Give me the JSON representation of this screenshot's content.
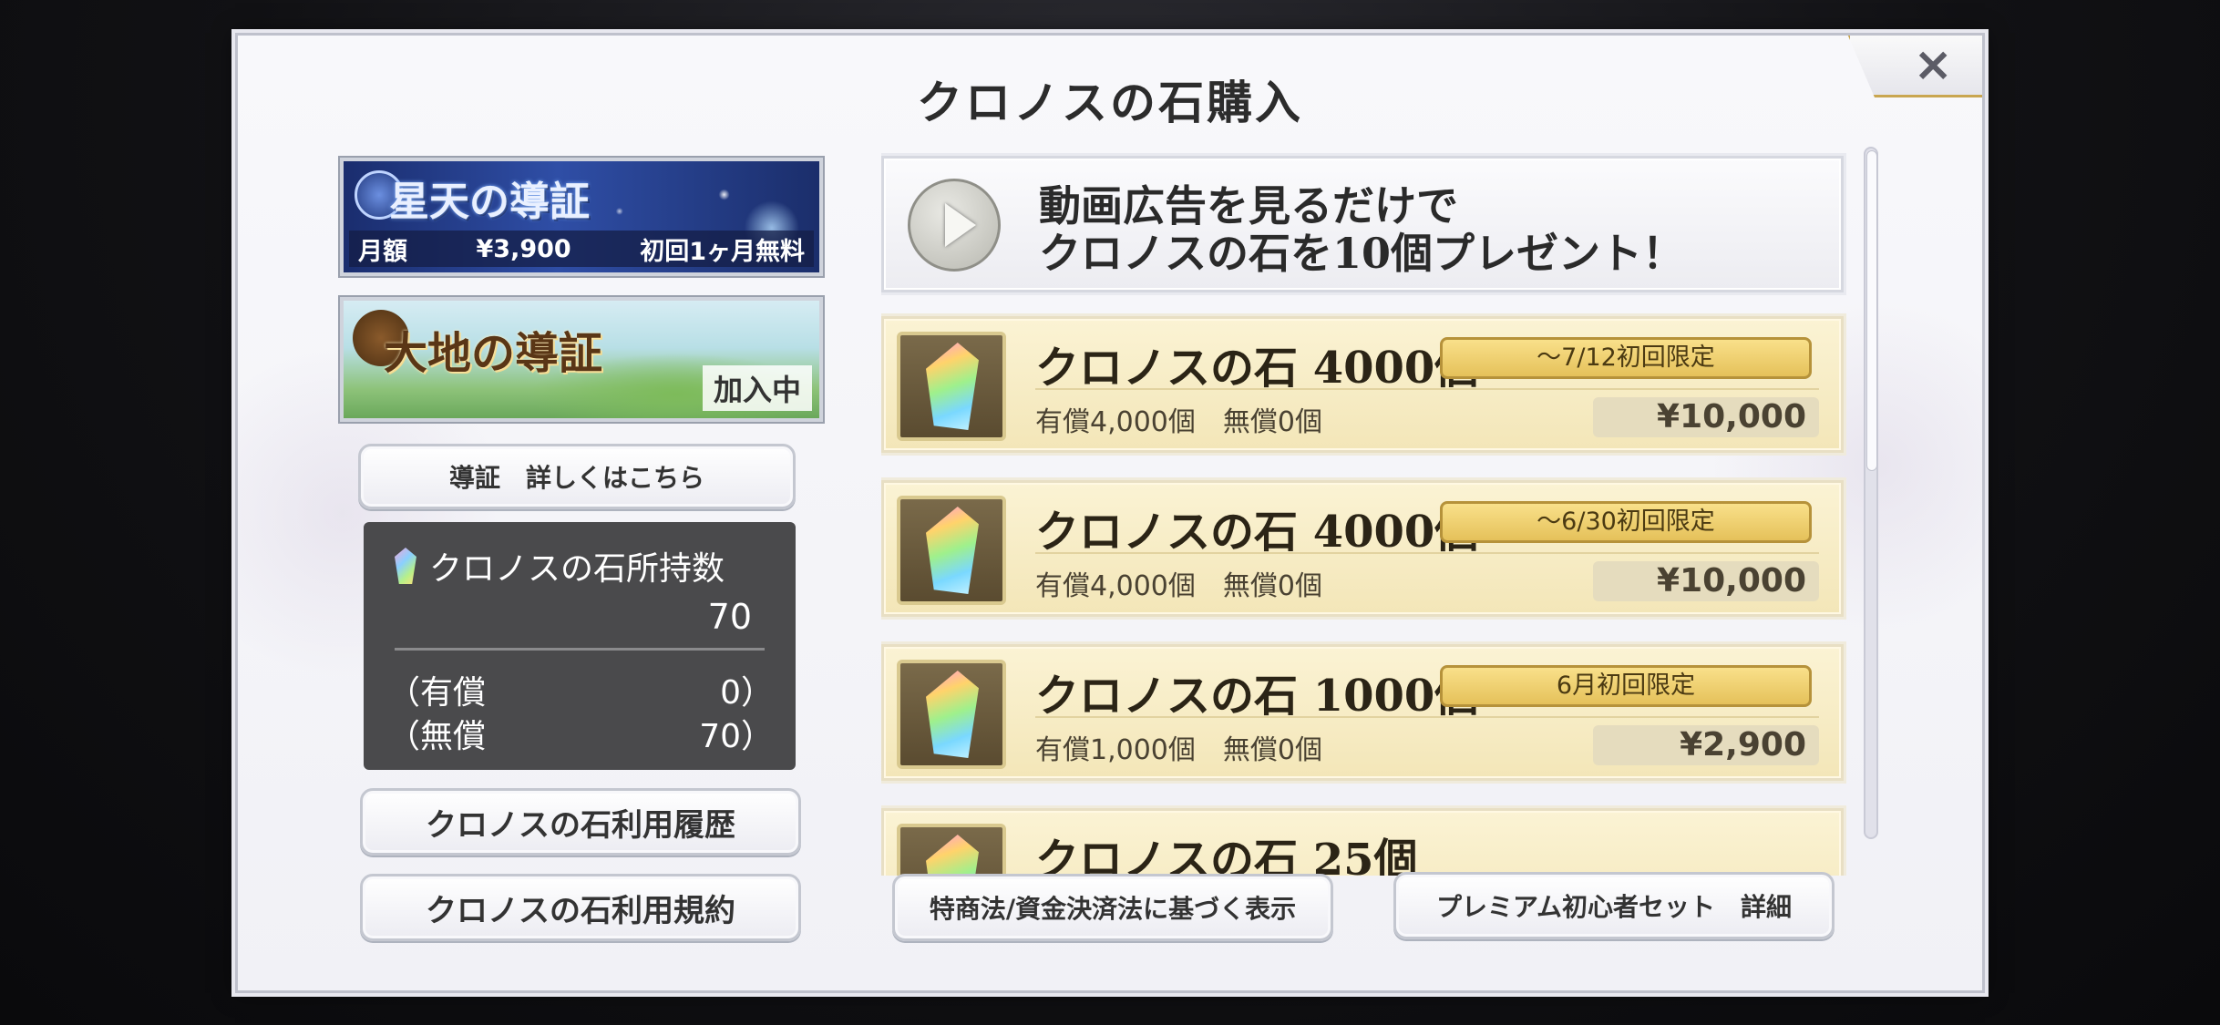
{
  "title": "クロノスの石購入",
  "close_icon": "×",
  "left": {
    "star_banner": {
      "title": "星天の導証",
      "monthly_label": "月額",
      "price": "¥3,900",
      "trial": "初回1ヶ月無料"
    },
    "earth_banner": {
      "title": "大地の導証",
      "status": "加入中"
    },
    "details_button": "導証　詳しくはこちら",
    "stone_panel": {
      "header": "クロノスの石所持数",
      "total": "70",
      "paid_label": "（有償",
      "paid_value": "0）",
      "free_label": "（無償",
      "free_value": "70）"
    },
    "history_button": "クロノスの石利用履歴",
    "terms_button": "クロノスの石利用規約"
  },
  "ad": {
    "line1": "動画広告を見るだけで",
    "line2": "クロノスの石を10個プレゼント！"
  },
  "products": [
    {
      "name": "クロノスの石 4000個",
      "badge": "～7/12初回限定",
      "sub": "有償4,000個　無償0個",
      "price": "¥10,000"
    },
    {
      "name": "クロノスの石 4000個",
      "badge": "～6/30初回限定",
      "sub": "有償4,000個　無償0個",
      "price": "¥10,000"
    },
    {
      "name": "クロノスの石 1000個",
      "badge": "6月初回限定",
      "sub": "有償1,000個　無償0個",
      "price": "¥2,900"
    },
    {
      "name": "クロノスの石 25個",
      "badge": "",
      "sub": "",
      "price": ""
    }
  ],
  "bottom": {
    "legal_button": "特商法/資金決済法に基づく表示",
    "premium_button": "プレミアム初心者セット　詳細"
  }
}
